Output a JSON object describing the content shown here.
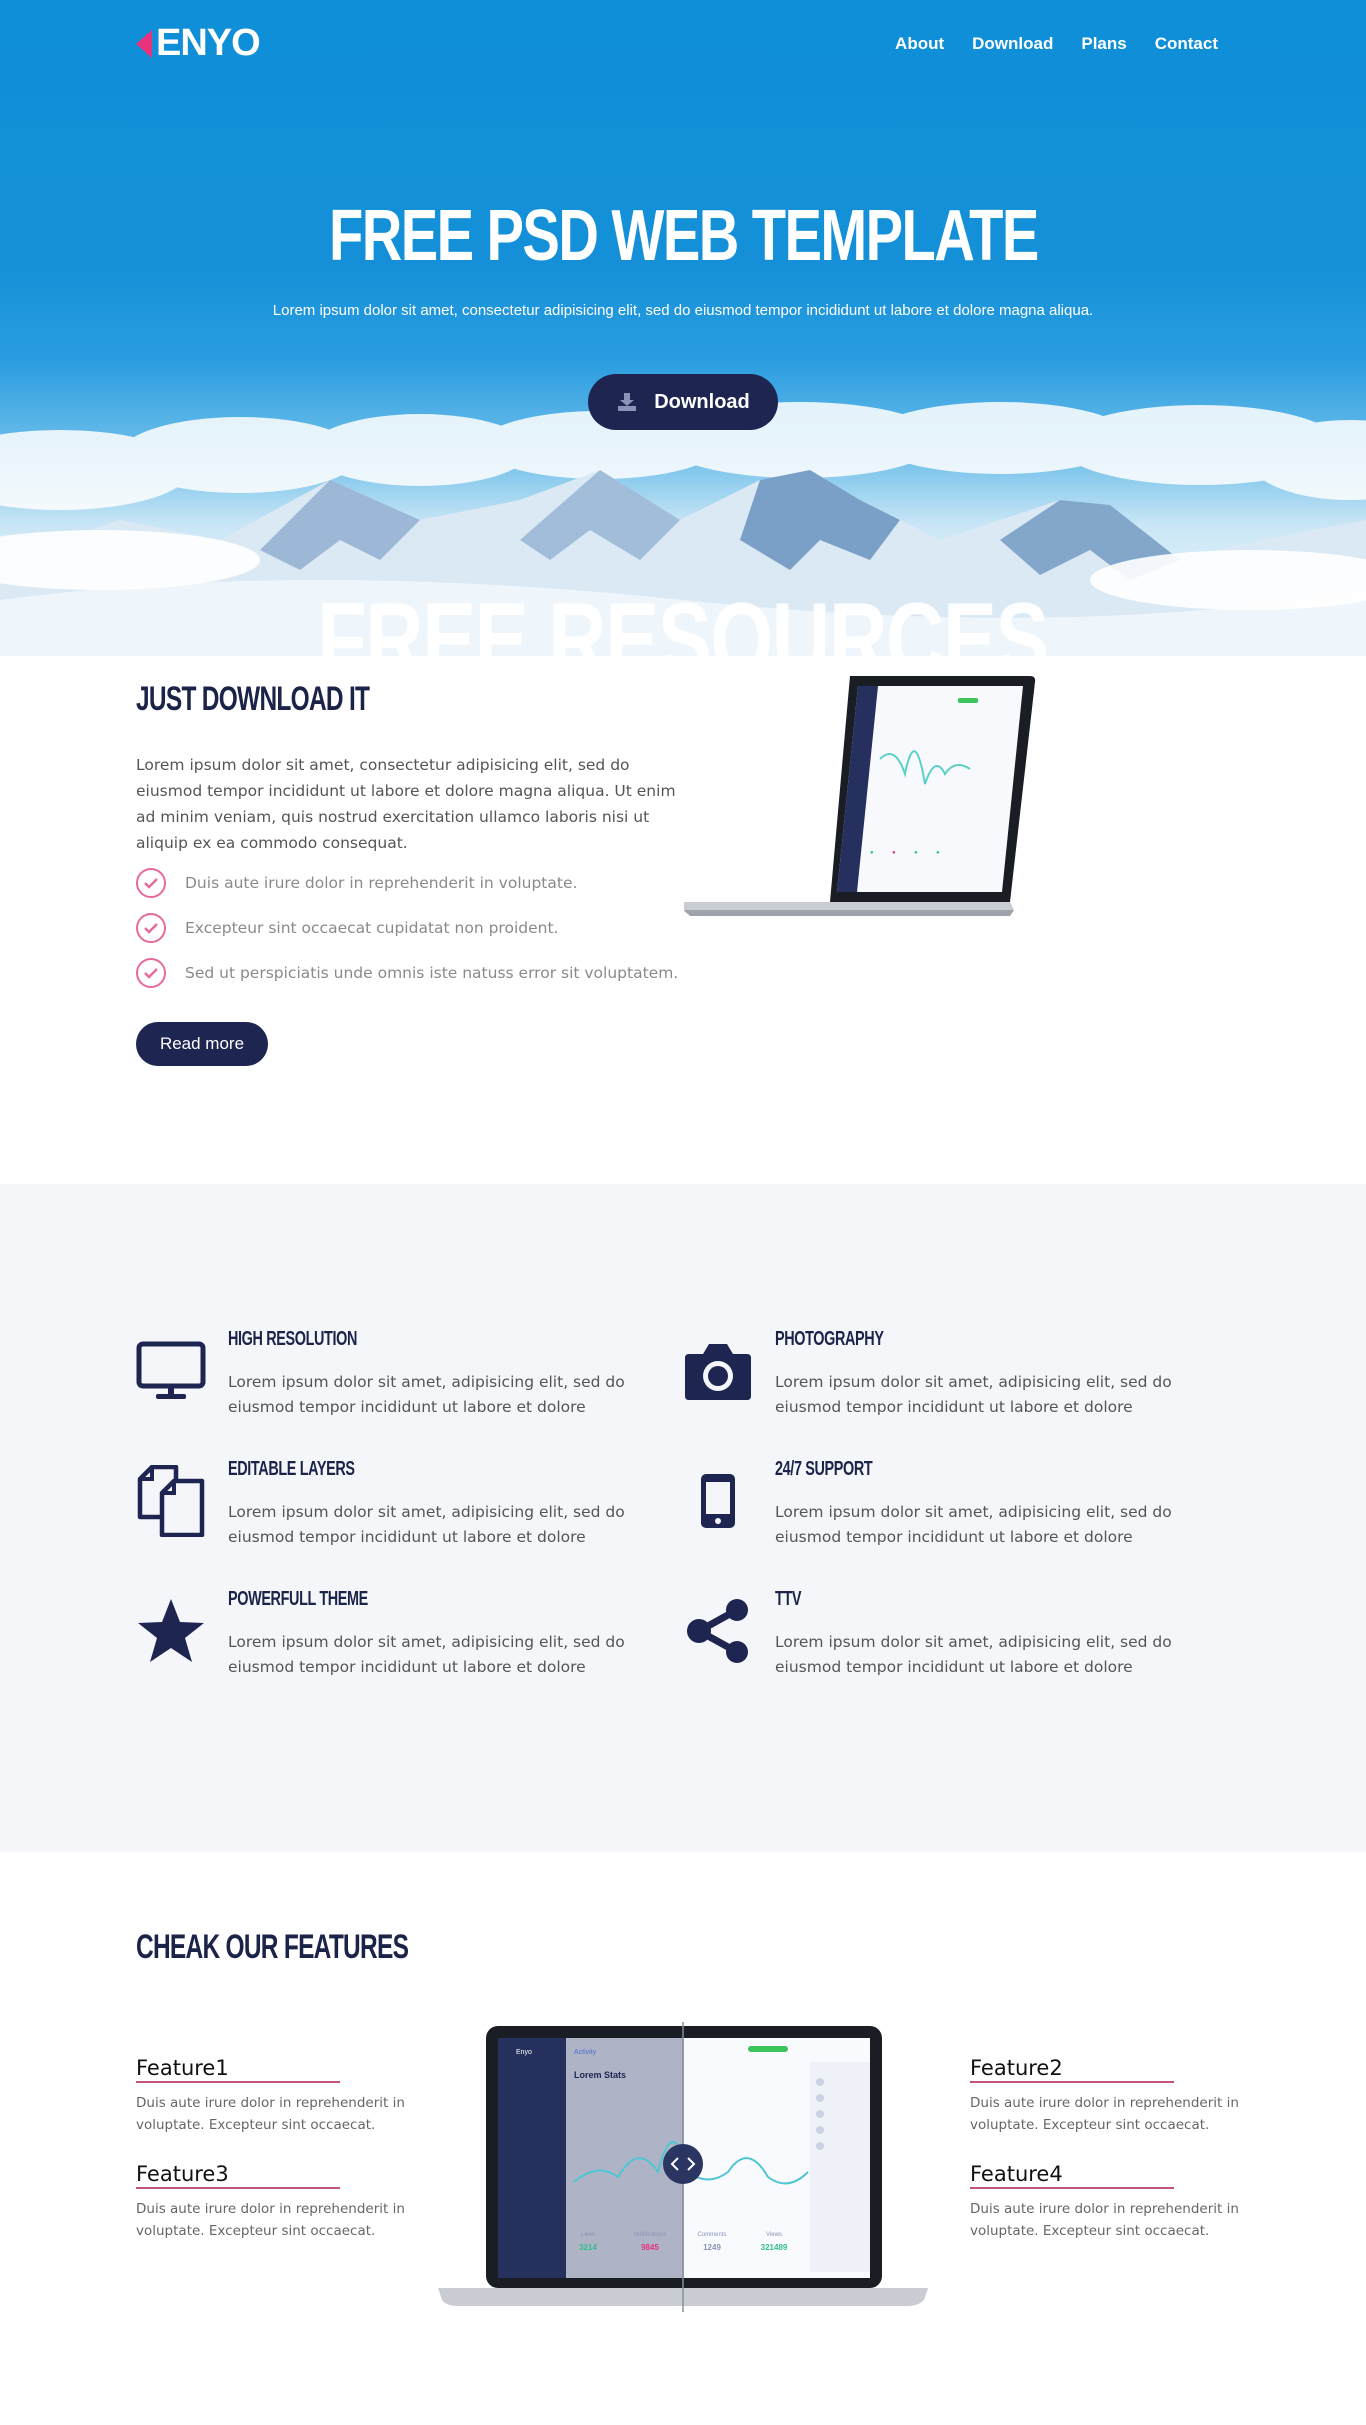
{
  "header": {
    "logo": "ENYO",
    "nav": [
      "About",
      "Download",
      "Plans",
      "Contact"
    ]
  },
  "hero": {
    "title": "FREE PSD WEB TEMPLATE",
    "subtitle": "Lorem ipsum dolor sit amet, consectetur adipisicing elit, sed do eiusmod tempor incididunt ut labore et dolore magna aliqua.",
    "download_label": "Download",
    "overlay_text": "FREE RESOURCES"
  },
  "about": {
    "title": "JUST DOWNLOAD IT",
    "text": "Lorem ipsum dolor sit amet, consectetur adipisicing elit, sed do eiusmod tempor incididunt ut labore et dolore magna aliqua. Ut enim ad minim veniam, quis nostrud exercitation ullamco laboris nisi ut aliquip ex ea commodo consequat.",
    "checks": [
      "Duis aute irure dolor in reprehenderit in voluptate.",
      "Excepteur sint occaecat cupidatat non proident.",
      "Sed ut perspiciatis unde omnis iste natuss error sit voluptatem."
    ],
    "read_more": "Read more"
  },
  "grid": {
    "items": [
      {
        "title": "HIGH RESOLUTION",
        "icon": "monitor-icon",
        "text": "Lorem ipsum dolor sit amet, adipisicing elit, sed do eiusmod tempor incididunt ut labore et dolore"
      },
      {
        "title": "PHOTOGRAPHY",
        "icon": "camera-icon",
        "text": "Lorem ipsum dolor sit amet, adipisicing elit, sed do eiusmod tempor incididunt ut labore et dolore"
      },
      {
        "title": "EDITABLE LAYERS",
        "icon": "layers-icon",
        "text": "Lorem ipsum dolor sit amet, adipisicing elit, sed do eiusmod tempor incididunt ut labore et dolore"
      },
      {
        "title": "24/7 SUPPORT",
        "icon": "phone-icon",
        "text": "Lorem ipsum dolor sit amet, adipisicing elit, sed do eiusmod tempor incididunt ut labore et dolore"
      },
      {
        "title": "POWERFULL THEME",
        "icon": "star-icon",
        "text": "Lorem ipsum dolor sit amet, adipisicing elit, sed do eiusmod tempor incididunt ut labore et dolore"
      },
      {
        "title": "TTV",
        "icon": "share-icon",
        "text": "Lorem ipsum dolor sit amet, adipisicing elit, sed do eiusmod tempor incididunt ut labore et dolore"
      }
    ]
  },
  "features": {
    "title": "CHEAK OUR FEATURES",
    "items": [
      {
        "title": "Feature1",
        "text": "Duis aute irure dolor in reprehenderit in voluptate. Excepteur sint occaecat."
      },
      {
        "title": "Feature2",
        "text": "Duis aute irure dolor in reprehenderit in voluptate. Excepteur sint occaecat."
      },
      {
        "title": "Feature3",
        "text": "Duis aute irure dolor in reprehenderit in voluptate. Excepteur sint occaecat."
      },
      {
        "title": "Feature4",
        "text": "Duis aute irure dolor in reprehenderit in voluptate. Excepteur sint occaecat."
      }
    ]
  },
  "mockup": {
    "app_name": "Enyo",
    "page_label": "Activity",
    "stats_title": "Lorem Stats",
    "stats": [
      {
        "label": "Likes",
        "value": "3214"
      },
      {
        "label": "Notifications",
        "value": "9845"
      },
      {
        "label": "Comments",
        "value": "1249"
      },
      {
        "label": "Views",
        "value": "321489"
      }
    ]
  },
  "colors": {
    "navy": "#1d2550",
    "accent_pink": "#e8327b",
    "hero_blue": "#0e8fd8",
    "grid_bg": "#f4f6fa"
  }
}
